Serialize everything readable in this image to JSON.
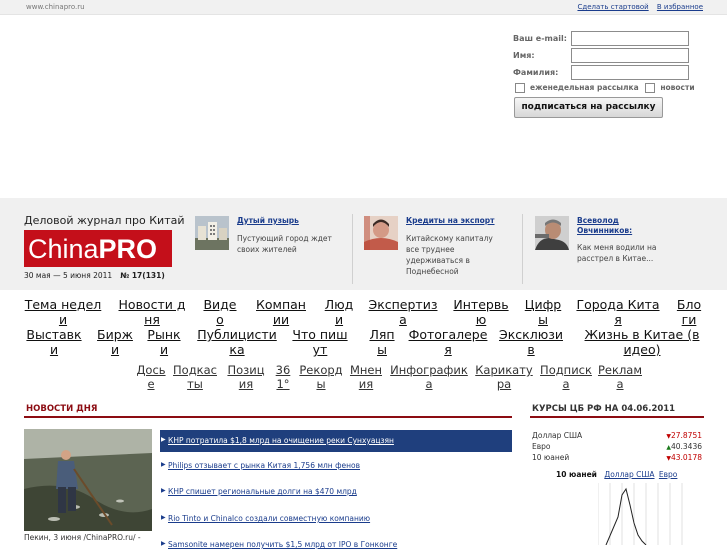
{
  "topbar": {
    "site": "www.chinapro.ru",
    "links": [
      "Сделать стартовой",
      "В избранное"
    ]
  },
  "subscribe": {
    "email_label": "Ваш e-mail:",
    "name_label": "Имя:",
    "surname_label": "Фамилия:",
    "weekly_label": "еженедельная рассылка",
    "news_label": "новости",
    "button_label": "подписаться на рассылку"
  },
  "header": {
    "tagline": "Деловой журнал про Китай",
    "logo_light": "China",
    "logo_bold": "PRO",
    "issue_dates": "30 мая — 5 июня 2011",
    "issue_number": "№ 17(131)",
    "brand_color": "#c40f1a"
  },
  "promos": [
    {
      "title": "Дутый пузырь",
      "desc": [
        "Пустующий город ждет",
        "своих жителей"
      ],
      "icon": "city-photo"
    },
    {
      "title": "Кредиты на экспорт",
      "desc": [
        "Китайскому капиталу",
        "все труднее",
        "удерживаться в",
        "Поднебесной"
      ],
      "icon": "banknote-portrait"
    },
    {
      "title": "Всеволод Овчинников:",
      "desc": [
        "Как меня водили на",
        "расстрел в Китае..."
      ],
      "icon": "portrait-photo"
    }
  ],
  "nav": {
    "row1": [
      "Тема недели",
      "Новости дня",
      "Видео",
      "Компании",
      "Люди",
      "Экспертиза",
      "Интервью",
      "Цифры",
      "Города Китая",
      "Блоги"
    ],
    "row2": [
      "Выставки",
      "Биржи",
      "Рынки",
      "Публицистика",
      "Что пишут",
      "Ляпы",
      "Фотогалерея",
      "Эксклюзив",
      "Жизнь в Китае (видео)"
    ],
    "row3": [
      "Досье",
      "Подкасты",
      "Позиция",
      "361°",
      "Рекорды",
      "Мнения",
      "Инфографика",
      "Карикатура",
      "Подписка",
      "Реклама"
    ]
  },
  "news": {
    "title": "НОВОСТИ ДНЯ",
    "caption": "Пекин, 3 июня /ChinaPRO.ru/ -",
    "items": [
      "КНР потратила $1,8 млрд на очищение реки Сунхуацзян",
      "Philips отзывает с рынка Китая 1,756 млн фенов",
      "КНР спишет региональные долги на $470 млрд",
      "Rio Tinto и Chinalco создали совместную компанию",
      "Samsonite намерен получить $1,5 млрд от IPO в Гонконге"
    ]
  },
  "rates": {
    "title": "КУРСЫ ЦБ РФ НА 04.06.2011",
    "rows": [
      {
        "name": "Доллар США",
        "dir": "▼",
        "value": "27.8751",
        "color": "#c00000"
      },
      {
        "name": "Евро",
        "dir": "▲",
        "value": "40.3436",
        "color": "#1a7a1a"
      },
      {
        "name": "10 юаней",
        "dir": "▼",
        "value": "43.0178",
        "color": "#c00000"
      }
    ],
    "chart_tab_active": "10 юаней",
    "chart_tabs": [
      "Доллар США",
      "Евро"
    ]
  }
}
